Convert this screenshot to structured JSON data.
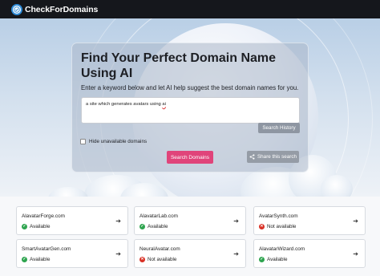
{
  "brand": {
    "name": "CheckForDomains",
    "icon": "globe-check-icon"
  },
  "hero": {
    "title": "Find Your Perfect Domain Name Using AI",
    "subtitle": "Enter a keyword below and let AI help suggest the best domain names for you.",
    "keyword_value_before": "a site which generates avatars using ",
    "keyword_value_underlined": "ai",
    "search_history_label": "Search History",
    "hide_unavailable_label": "Hide unavailable domains",
    "hide_unavailable_checked": false,
    "search_button_label": "Search Domains",
    "share_button_label": "Share this search"
  },
  "colors": {
    "available": "#2ea44f",
    "not_available": "#d93025",
    "primary": "#e0447a"
  },
  "domains": [
    {
      "name": "AlavatarForge.com",
      "status": "Available",
      "available": true
    },
    {
      "name": "AlavatarLab.com",
      "status": "Available",
      "available": true
    },
    {
      "name": "AvatarSynth.com",
      "status": "Not available",
      "available": false
    },
    {
      "name": "SmartAvatarGen.com",
      "status": "Available",
      "available": true
    },
    {
      "name": "NeuralAvatar.com",
      "status": "Not available",
      "available": false
    },
    {
      "name": "AlavatarWizard.com",
      "status": "Available",
      "available": true
    }
  ]
}
